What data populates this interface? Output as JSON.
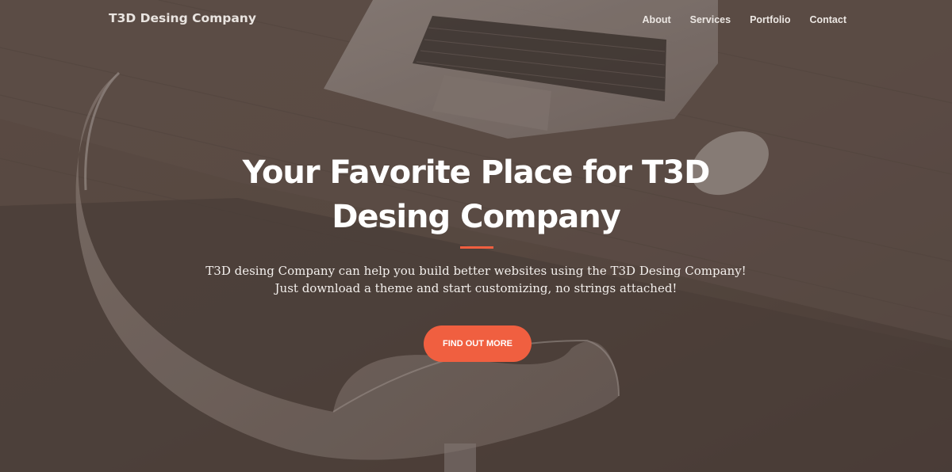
{
  "navbar": {
    "brand": "T3D Desing Company",
    "links": [
      "About",
      "Services",
      "Portfolio",
      "Contact"
    ]
  },
  "hero": {
    "headline_line1": "Your Favorite Place for T3D",
    "headline_line2": "Desing Company",
    "subtext_line1": "T3D desing Company can help you build better websites using the T3D Desing Company!",
    "subtext_line2": "Just download a theme and start customizing, no strings attached!",
    "cta_label": "FIND OUT MORE"
  },
  "colors": {
    "accent": "#f05f40",
    "background_tint": "#4f433c",
    "text": "#ffffff"
  },
  "background_image": "photo of a laptop, mouse and white chair on a wooden desk, dimmed with a brown overlay"
}
